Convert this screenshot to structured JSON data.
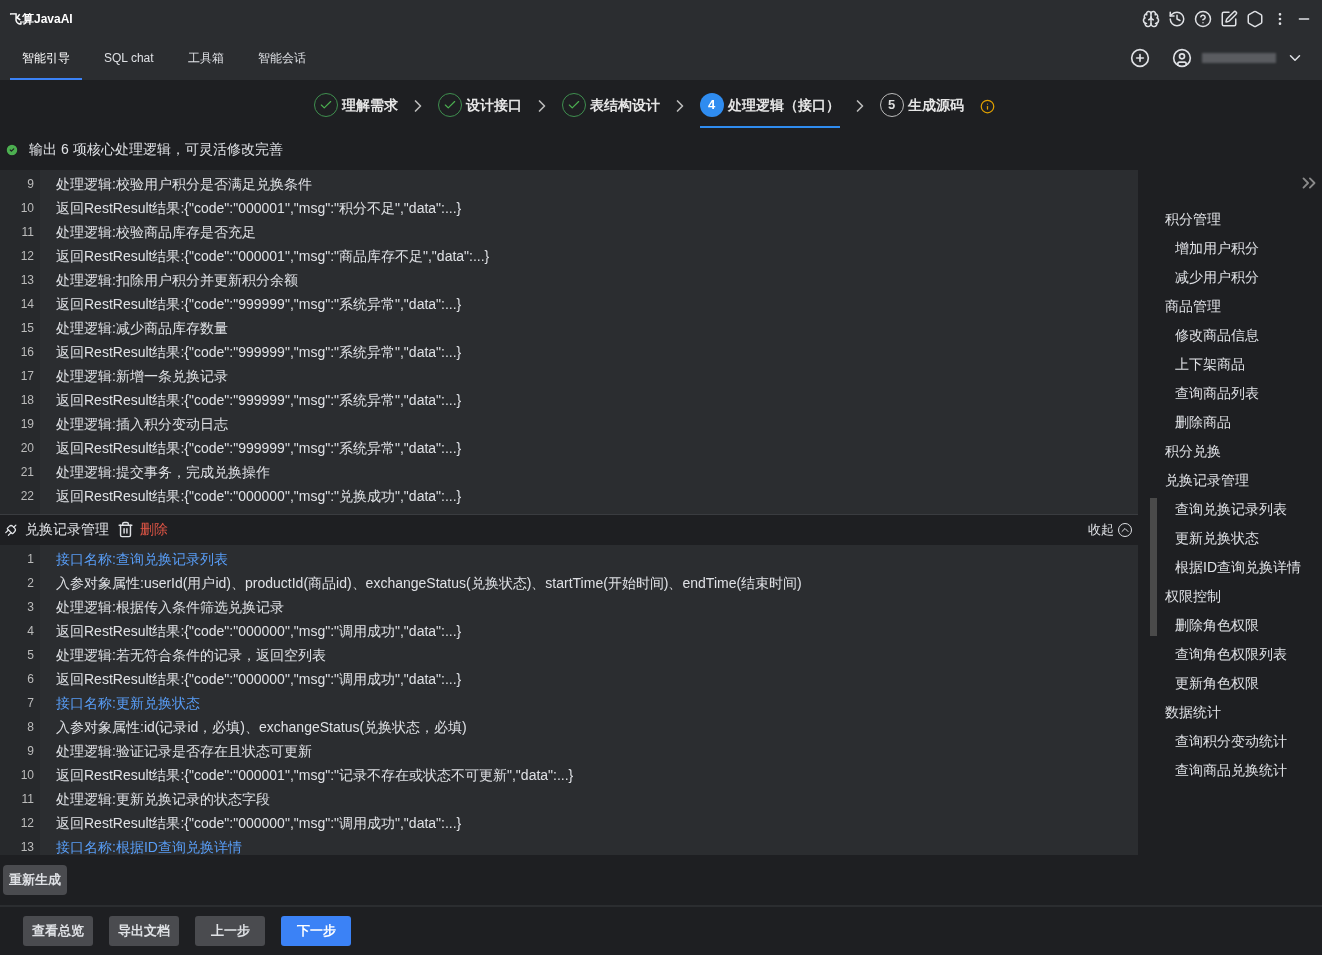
{
  "app": {
    "title": "飞算JavaAI"
  },
  "tabs": [
    {
      "label": "智能引导",
      "selected": true
    },
    {
      "label": "SQL chat",
      "selected": false
    },
    {
      "label": "工具箱",
      "selected": false
    },
    {
      "label": "智能会话",
      "selected": false
    }
  ],
  "steps": [
    {
      "label": "理解需求",
      "kind": "done"
    },
    {
      "label": "设计接口",
      "kind": "done"
    },
    {
      "label": "表结构设计",
      "kind": "done"
    },
    {
      "number": "4",
      "label": "处理逻辑（接口）",
      "kind": "active"
    },
    {
      "number": "5",
      "label": "生成源码",
      "kind": "pending"
    }
  ],
  "status": {
    "text": "输出 6 项核心处理逻辑，可灵活修改完善"
  },
  "editor_top": {
    "lines": [
      {
        "number": "9",
        "kind": "text",
        "text": "处理逻辑:校验用户积分是否满足兑换条件"
      },
      {
        "number": "10",
        "kind": "text",
        "text": "返回RestResult结果:{\"code\":\"000001\",\"msg\":\"积分不足\",\"data\":...}"
      },
      {
        "number": "11",
        "kind": "text",
        "text": "处理逻辑:校验商品库存是否充足"
      },
      {
        "number": "12",
        "kind": "text",
        "text": "返回RestResult结果:{\"code\":\"000001\",\"msg\":\"商品库存不足\",\"data\":...}"
      },
      {
        "number": "13",
        "kind": "text",
        "text": "处理逻辑:扣除用户积分并更新积分余额"
      },
      {
        "number": "14",
        "kind": "text",
        "text": "返回RestResult结果:{\"code\":\"999999\",\"msg\":\"系统异常\",\"data\":...}"
      },
      {
        "number": "15",
        "kind": "text",
        "text": "处理逻辑:减少商品库存数量"
      },
      {
        "number": "16",
        "kind": "text",
        "text": "返回RestResult结果:{\"code\":\"999999\",\"msg\":\"系统异常\",\"data\":...}"
      },
      {
        "number": "17",
        "kind": "text",
        "text": "处理逻辑:新增一条兑换记录"
      },
      {
        "number": "18",
        "kind": "text",
        "text": "返回RestResult结果:{\"code\":\"999999\",\"msg\":\"系统异常\",\"data\":...}"
      },
      {
        "number": "19",
        "kind": "text",
        "text": "处理逻辑:插入积分变动日志"
      },
      {
        "number": "20",
        "kind": "text",
        "text": "返回RestResult结果:{\"code\":\"999999\",\"msg\":\"系统异常\",\"data\":...}"
      },
      {
        "number": "21",
        "kind": "text",
        "text": "处理逻辑:提交事务，完成兑换操作"
      },
      {
        "number": "22",
        "kind": "text",
        "text": "返回RestResult结果:{\"code\":\"000000\",\"msg\":\"兑换成功\",\"data\":...}"
      }
    ]
  },
  "section": {
    "title": "兑换记录管理",
    "delete": "删除",
    "collapse": "收起"
  },
  "editor_bottom": {
    "lines": [
      {
        "number": "1",
        "kind": "link",
        "text": "接口名称:查询兑换记录列表"
      },
      {
        "number": "2",
        "kind": "text",
        "text": "入参对象属性:userId(用户id)、productId(商品id)、exchangeStatus(兑换状态)、startTime(开始时间)、endTime(结束时间)"
      },
      {
        "number": "3",
        "kind": "text",
        "text": "处理逻辑:根据传入条件筛选兑换记录"
      },
      {
        "number": "4",
        "kind": "text",
        "text": "返回RestResult结果:{\"code\":\"000000\",\"msg\":\"调用成功\",\"data\":...}"
      },
      {
        "number": "5",
        "kind": "text",
        "text": "处理逻辑:若无符合条件的记录，返回空列表"
      },
      {
        "number": "6",
        "kind": "text",
        "text": "返回RestResult结果:{\"code\":\"000000\",\"msg\":\"调用成功\",\"data\":...}"
      },
      {
        "number": "7",
        "kind": "link",
        "text": "接口名称:更新兑换状态"
      },
      {
        "number": "8",
        "kind": "text",
        "text": "入参对象属性:id(记录id，必填)、exchangeStatus(兑换状态，必填)"
      },
      {
        "number": "9",
        "kind": "text",
        "text": "处理逻辑:验证记录是否存在且状态可更新"
      },
      {
        "number": "10",
        "kind": "text",
        "text": "返回RestResult结果:{\"code\":\"000001\",\"msg\":\"记录不存在或状态不可更新\",\"data\":...}"
      },
      {
        "number": "11",
        "kind": "text",
        "text": "处理逻辑:更新兑换记录的状态字段"
      },
      {
        "number": "12",
        "kind": "text",
        "text": "返回RestResult结果:{\"code\":\"000000\",\"msg\":\"调用成功\",\"data\":...}"
      },
      {
        "number": "13",
        "kind": "link",
        "text": "接口名称:根据ID查询兑换详情"
      }
    ]
  },
  "outline": [
    {
      "label": "积分管理",
      "children": [
        {
          "label": "增加用户积分"
        },
        {
          "label": "减少用户积分"
        }
      ]
    },
    {
      "label": "商品管理",
      "children": [
        {
          "label": "修改商品信息"
        },
        {
          "label": "上下架商品"
        },
        {
          "label": "查询商品列表"
        },
        {
          "label": "删除商品"
        }
      ]
    },
    {
      "label": "积分兑换"
    },
    {
      "label": "兑换记录管理",
      "children": [
        {
          "label": "查询兑换记录列表"
        },
        {
          "label": "更新兑换状态"
        },
        {
          "label": "根据ID查询兑换详情"
        }
      ]
    },
    {
      "label": "权限控制",
      "children": [
        {
          "label": "删除角色权限"
        },
        {
          "label": "查询角色权限列表"
        },
        {
          "label": "更新角色权限"
        }
      ]
    },
    {
      "label": "数据统计",
      "children": [
        {
          "label": "查询积分变动统计"
        },
        {
          "label": "查询商品兑换统计"
        }
      ]
    }
  ],
  "regenerate": "重新生成",
  "footer_buttons": [
    {
      "label": "查看总览",
      "kind": "secondary"
    },
    {
      "label": "导出文档",
      "kind": "secondary"
    },
    {
      "label": "上一步",
      "kind": "secondary"
    },
    {
      "label": "下一步",
      "kind": "primary"
    }
  ]
}
